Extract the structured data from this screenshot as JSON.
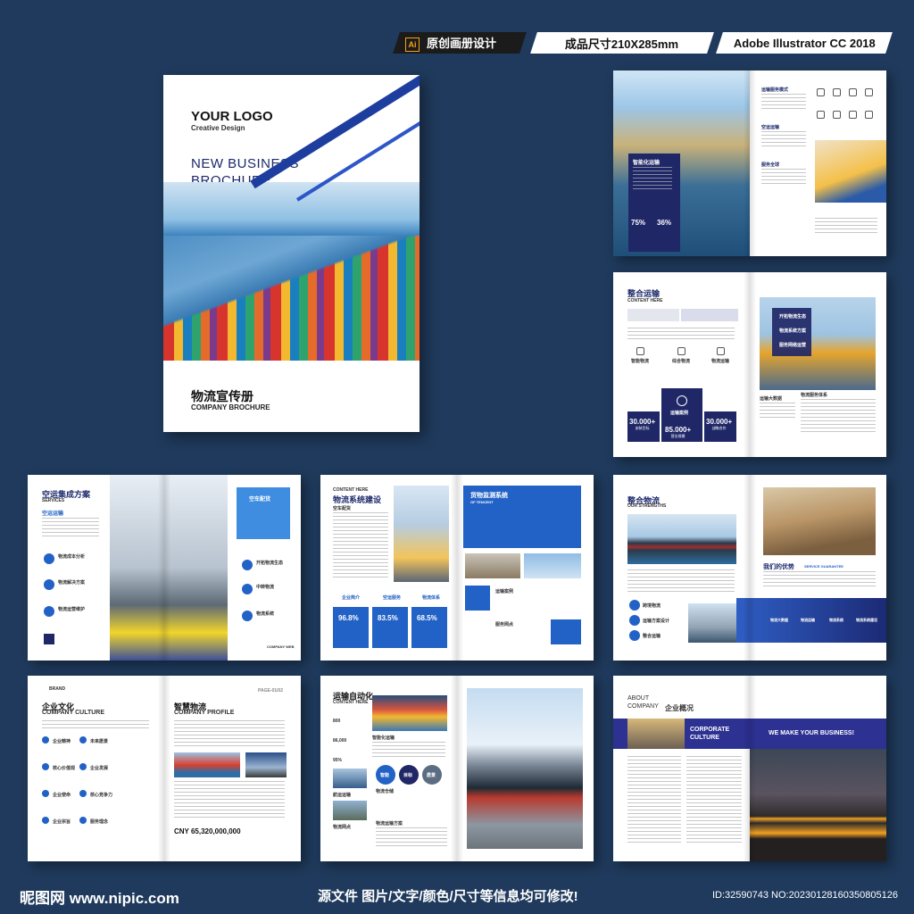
{
  "badges": {
    "design": "原创画册设计",
    "size": "成品尺寸210X285mm",
    "software": "Adobe Illustrator CC 2018",
    "ai_icon": "Ai"
  },
  "cover": {
    "logo": "YOUR LOGO",
    "logo_sub": "Creative Design",
    "title_line1": "NEW BUSINESS",
    "title_line2": "BROCHURE",
    "cn_title": "物流宣传册",
    "en_title": "COMPANY BROCHURE"
  },
  "spread1": {
    "heading": "智能化运输",
    "stat1": "75%",
    "stat2": "36%",
    "side1": "运输服务模式",
    "side2": "空运运输",
    "side3": "服务全球"
  },
  "spread2": {
    "heading": "整合运输",
    "sub": "CONTENT HERE",
    "box_label": "运输案例",
    "stat1": "30.000+",
    "stat1_label": "安装目标",
    "stat2": "85.000+",
    "stat2_label": "营业规模",
    "stat3": "30.000+",
    "stat3_label": "战略合作",
    "tag1": "智能物流",
    "tag2": "综合物流",
    "tag3": "物流运输",
    "bullets": [
      "开拓物流生态",
      "物流系统方案",
      "服务网络运营"
    ],
    "bottom1": "运输大数据",
    "bottom2": "物流服务体系"
  },
  "spread3": {
    "heading": "空运集成方案",
    "sub": "SERVICES",
    "blue_label": "空运运输",
    "items": [
      "物流成本分析",
      "物流解决方案",
      "物流运营维护"
    ],
    "box_title": "空车配货",
    "right_items": [
      "开拓物流生态",
      "中转物流",
      "物流系统"
    ],
    "footer": "COMPANY WEB"
  },
  "spread4": {
    "sub": "CONTENT HERE",
    "heading": "物流系统建设",
    "label1": "空车配货",
    "stat1": "96.8%",
    "stat2": "83.5%",
    "stat3": "68.5%",
    "tag1": "企业简介",
    "tag2": "空运服务",
    "tag3": "物流体系",
    "box_title": "货物监测系统",
    "box_sub": "OF TENCENT",
    "case_title": "运输案例",
    "case_sub": "服务网点"
  },
  "spread5": {
    "heading": "整合物流",
    "sub": "OUR STRENGTHS",
    "advantage": "我们的优势",
    "advantage_sub": "SERVICE GUARANTEE",
    "list": [
      "跨境物流",
      "运输方案设计",
      "整合运输"
    ],
    "bar_items": [
      "物流大数据",
      "物流运输",
      "物流系统",
      "物流系统建设"
    ]
  },
  "spread6": {
    "brand": "BRAND",
    "heading": "企业文化",
    "sub": "COMPANY CULTURE",
    "heading2": "智慧物流",
    "sub2": "COMPANY PROFILE",
    "page": "PAGE-01/02",
    "left_items": [
      "企业精神",
      "核心价值观",
      "企业使命",
      "企业宗旨"
    ],
    "right_items": [
      "未来愿景",
      "企业发展",
      "核心竞争力",
      "服务理念"
    ],
    "money": "CNY 65,320,000,000"
  },
  "spread7": {
    "heading": "运输自动化",
    "sub": "CONTENT HERE",
    "numbers": [
      "800",
      "86,000",
      "95%"
    ],
    "side_title": "智能化运输",
    "circles": [
      "智能",
      "目标",
      "愿景"
    ],
    "items": [
      "航运运输",
      "物流网点",
      "物流仓储"
    ],
    "bottom": "物流运输方案"
  },
  "spread8": {
    "about_line1": "ABOUT",
    "about_line2": "COMPANY",
    "about_cn": "企业概况",
    "bar_left1": "CORPORATE",
    "bar_left2": "CULTURE",
    "bar_right": "WE MAKE YOUR BUSINESS!"
  },
  "footer": {
    "logo": "昵图网 www.nipic.com",
    "middle": "源文件 图片/文字/颜色/尺寸等信息均可修改!",
    "id": "ID:32590743 NO:20230128160350805126"
  },
  "colors": {
    "background": "#1f3a5c",
    "navy": "#1f2767",
    "accent": "#2262c6"
  }
}
